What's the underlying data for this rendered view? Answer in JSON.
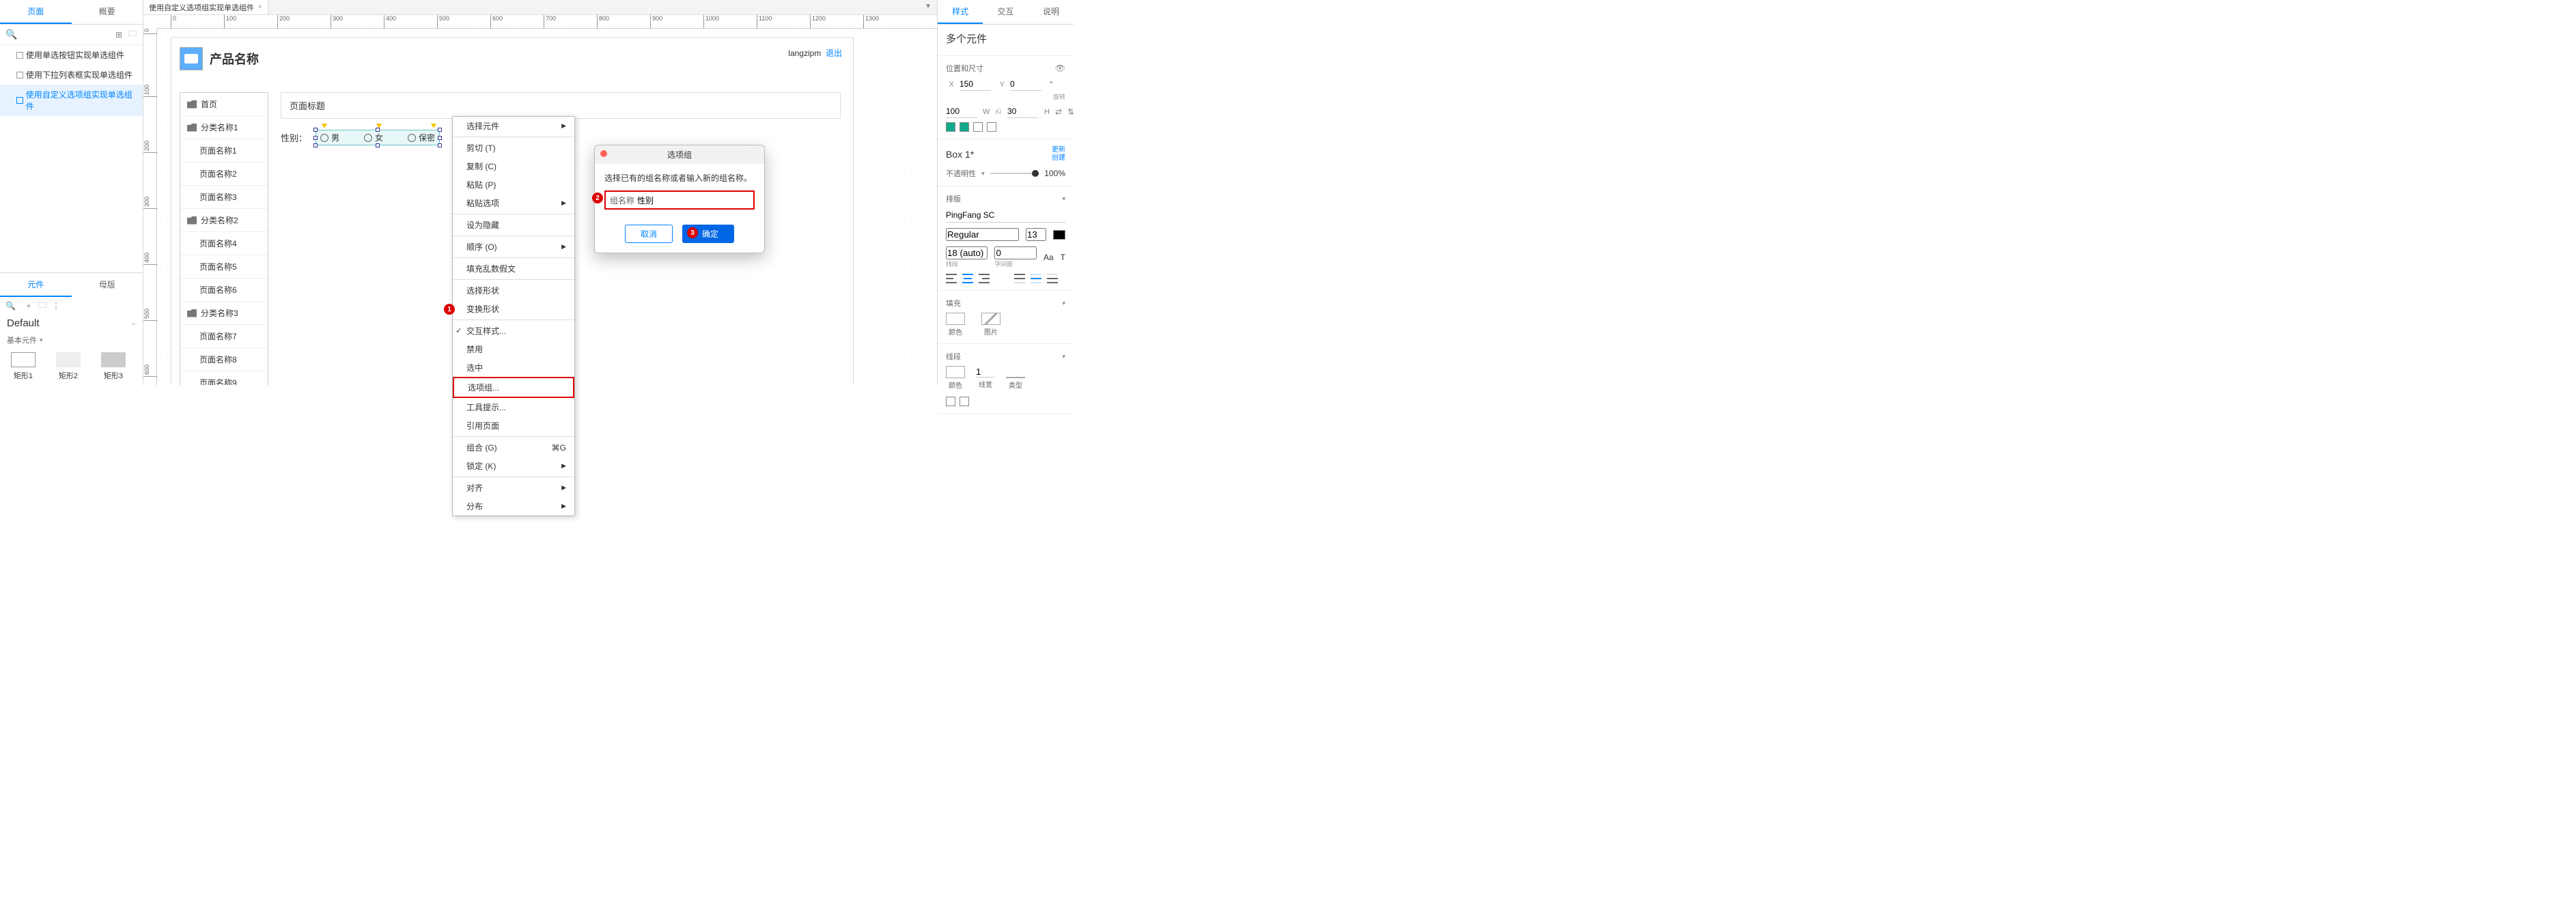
{
  "left": {
    "tabs": [
      "页面",
      "概要"
    ],
    "pages": [
      "使用单选按钮实现单选组件",
      "使用下拉列表框实现单选组件",
      "使用自定义选项组实现单选组件"
    ],
    "active_page": 2,
    "comp_tabs": [
      "元件",
      "母版"
    ],
    "default_label": "Default",
    "group_label": "基本元件",
    "shapes": [
      "矩形1",
      "矩形2",
      "矩形3"
    ]
  },
  "file_tab": {
    "label": "使用自定义选项组实现单选组件"
  },
  "ruler_h": [
    0,
    100,
    200,
    300,
    400,
    500,
    600,
    700,
    800,
    900,
    1000,
    1100,
    1200,
    1300
  ],
  "ruler_v": [
    0,
    100,
    200,
    300,
    400,
    500,
    600
  ],
  "page": {
    "product_title": "产品名称",
    "user": "langzipm",
    "logout": "退出",
    "sidebar": [
      {
        "cat": "首页"
      },
      {
        "cat": "分类名称1",
        "subs": [
          "页面名称1",
          "页面名称2",
          "页面名称3"
        ]
      },
      {
        "cat": "分类名称2",
        "subs": [
          "页面名称4",
          "页面名称5",
          "页面名称6"
        ]
      },
      {
        "cat": "分类名称3",
        "subs": [
          "页面名称7",
          "页面名称8",
          "页面名称9"
        ]
      }
    ],
    "page_title": "页面标题",
    "gender_label": "性别：",
    "options": [
      "男",
      "女",
      "保密"
    ]
  },
  "ctx": {
    "select_element": "选择元件",
    "cut": "剪切 (T)",
    "copy": "复制 (C)",
    "paste": "粘贴 (P)",
    "paste_opts": "粘贴选项",
    "hide": "设为隐藏",
    "order": "顺序 (O)",
    "lorem": "填充乱数假文",
    "sel_shape": "选择形状",
    "chg_shape": "变换形状",
    "ix_style": "交互样式...",
    "disable": "禁用",
    "selected": "选中",
    "option_group": "选项组...",
    "tooltip": "工具提示...",
    "ref_page": "引用页面",
    "group": "组合 (G)",
    "group_key": "⌘G",
    "lock": "锁定 (K)",
    "align": "对齐",
    "distribute": "分布"
  },
  "dialog": {
    "title": "选项组",
    "msg": "选择已有的组名称或者输入新的组名称。",
    "input_label": "组名称",
    "input_value": "性别",
    "cancel": "取消",
    "ok": "确定"
  },
  "callouts": {
    "c1": "1",
    "c2": "2",
    "c3": "3"
  },
  "right": {
    "tabs": [
      "样式",
      "交互",
      "说明"
    ],
    "multi": "多个元件",
    "pos_label": "位置和尺寸",
    "x": "150",
    "y": "0",
    "rot": "°",
    "rot_lbl": "旋转",
    "w": "100",
    "h": "30",
    "box": "Box 1*",
    "update": "更新",
    "create": "创建",
    "opacity_label": "不透明性",
    "opacity": "100%",
    "typo_label": "排版",
    "font": "PingFang SC",
    "weight": "Regular",
    "size": "13",
    "line": "18 (auto)",
    "line_lbl": "线段",
    "char": "0",
    "char_lbl": "字间距",
    "aa": "Aa",
    "fill_label": "填充",
    "fill_color": "颜色",
    "fill_image": "图片",
    "stroke_label": "线段",
    "stroke_color": "颜色",
    "stroke_w": "1",
    "stroke_w_lbl": "线宽",
    "stroke_type": "类型"
  }
}
